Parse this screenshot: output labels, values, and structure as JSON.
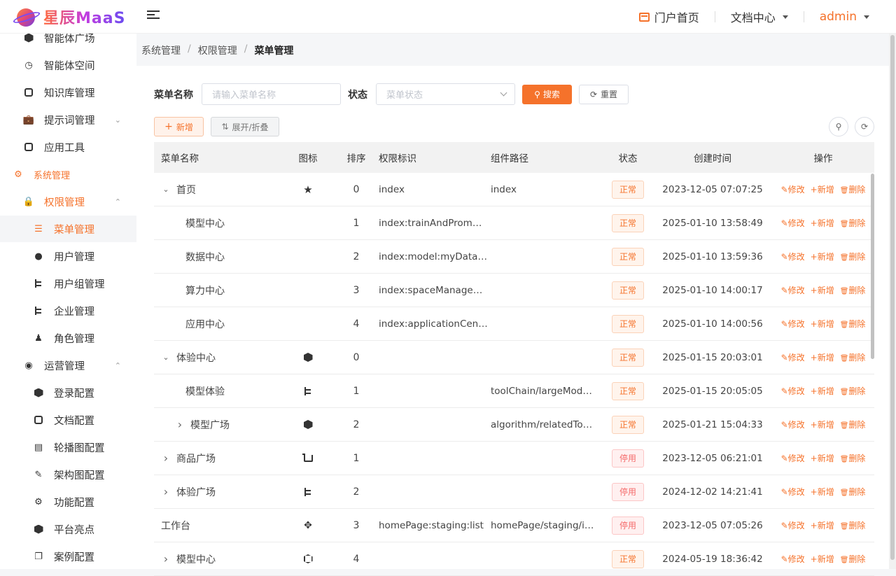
{
  "header": {
    "logo_text": "星辰MaaS",
    "portal": "门户首页",
    "docs": "文档中心",
    "user": "admin"
  },
  "sidebar": {
    "items": [
      {
        "label": "智能体广场",
        "icon": "hexagon-icon",
        "level": 1
      },
      {
        "label": "智能体空间",
        "icon": "clock-icon",
        "level": 1
      },
      {
        "label": "知识库管理",
        "icon": "database-icon",
        "level": 1
      },
      {
        "label": "提示词管理",
        "icon": "briefcase-icon",
        "level": 1,
        "chevron": "down"
      },
      {
        "label": "应用工具",
        "icon": "tools-icon",
        "level": 1
      },
      {
        "label": "系统管理",
        "icon": "gear-icon",
        "level": 0,
        "state": "open"
      },
      {
        "label": "权限管理",
        "icon": "lock-icon",
        "level": 1,
        "chevron": "up",
        "state": "open"
      },
      {
        "label": "菜单管理",
        "icon": "tree-table-icon",
        "level": 2,
        "state": "active"
      },
      {
        "label": "用户管理",
        "icon": "user-icon",
        "level": 2
      },
      {
        "label": "用户组管理",
        "icon": "tree-icon",
        "level": 2
      },
      {
        "label": "企业管理",
        "icon": "tree-icon",
        "level": 2
      },
      {
        "label": "角色管理",
        "icon": "peoples-icon",
        "level": 2
      },
      {
        "label": "运营管理",
        "icon": "operation-icon",
        "level": 1,
        "chevron": "up"
      },
      {
        "label": "登录配置",
        "icon": "hexagon-icon",
        "level": 2
      },
      {
        "label": "文档配置",
        "icon": "document-icon",
        "level": 2
      },
      {
        "label": "轮播图配置",
        "icon": "chart-icon",
        "level": 2
      },
      {
        "label": "架构图配置",
        "icon": "edit-icon",
        "level": 2
      },
      {
        "label": "功能配置",
        "icon": "gear-icon",
        "level": 2
      },
      {
        "label": "平台亮点",
        "icon": "hexagon-icon",
        "level": 2
      },
      {
        "label": "案例配置",
        "icon": "copy-icon",
        "level": 2
      }
    ]
  },
  "breadcrumb": [
    "系统管理",
    "权限管理",
    "菜单管理"
  ],
  "filter": {
    "name_label": "菜单名称",
    "name_placeholder": "请输入菜单名称",
    "status_label": "状态",
    "status_placeholder": "菜单状态",
    "search": "搜索",
    "reset": "重置"
  },
  "toolbar": {
    "add": "新增",
    "expand": "展开/折叠"
  },
  "table": {
    "columns": [
      "菜单名称",
      "图标",
      "排序",
      "权限标识",
      "组件路径",
      "状态",
      "创建时间",
      "操作"
    ],
    "ops": {
      "edit": "修改",
      "add": "新增",
      "delete": "删除"
    },
    "rows": [
      {
        "name": "首页",
        "tree": "expanded",
        "indent": 0,
        "icon": "star-icon",
        "order": "0",
        "perm": "index",
        "path": "index",
        "status": "正常",
        "status_kind": "ok",
        "time": "2023-12-05 07:07:25"
      },
      {
        "name": "模型中心",
        "tree": "leaf",
        "indent": 1,
        "icon": "",
        "order": "1",
        "perm": "index:trainAndProm…",
        "path": "",
        "status": "正常",
        "status_kind": "ok",
        "time": "2025-01-10 13:58:49"
      },
      {
        "name": "数据中心",
        "tree": "leaf",
        "indent": 1,
        "icon": "",
        "order": "2",
        "perm": "index:model:myData…",
        "path": "",
        "status": "正常",
        "status_kind": "ok",
        "time": "2025-01-10 13:59:36"
      },
      {
        "name": "算力中心",
        "tree": "leaf",
        "indent": 1,
        "icon": "",
        "order": "3",
        "perm": "index:spaceManage…",
        "path": "",
        "status": "正常",
        "status_kind": "ok",
        "time": "2025-01-10 14:00:17"
      },
      {
        "name": "应用中心",
        "tree": "leaf",
        "indent": 1,
        "icon": "",
        "order": "4",
        "perm": "index:applicationCen…",
        "path": "",
        "status": "正常",
        "status_kind": "ok",
        "time": "2025-01-10 14:00:56"
      },
      {
        "name": "体验中心",
        "tree": "expanded",
        "indent": 0,
        "icon": "cube-icon",
        "order": "0",
        "perm": "",
        "path": "",
        "status": "正常",
        "status_kind": "ok",
        "time": "2025-01-15 20:03:01"
      },
      {
        "name": "模型体验",
        "tree": "leaf",
        "indent": 1,
        "icon": "tree-icon",
        "order": "1",
        "perm": "",
        "path": "toolChain/largeMod…",
        "status": "正常",
        "status_kind": "ok",
        "time": "2025-01-15 20:05:05"
      },
      {
        "name": "模型广场",
        "tree": "collapsed",
        "indent": 1,
        "icon": "cube-icon",
        "order": "2",
        "perm": "",
        "path": "algorithm/relatedTo…",
        "status": "正常",
        "status_kind": "ok",
        "time": "2025-01-21 15:04:33"
      },
      {
        "name": "商品广场",
        "tree": "collapsed",
        "indent": 0,
        "icon": "cart-icon",
        "order": "1",
        "perm": "",
        "path": "",
        "status": "停用",
        "status_kind": "stop",
        "time": "2023-12-05 06:21:01"
      },
      {
        "name": "体验广场",
        "tree": "collapsed",
        "indent": 0,
        "icon": "tree-icon",
        "order": "2",
        "perm": "",
        "path": "",
        "status": "停用",
        "status_kind": "stop",
        "time": "2024-12-02 14:21:41"
      },
      {
        "name": "工作台",
        "tree": "none",
        "indent": 0,
        "icon": "move-icon",
        "order": "3",
        "perm": "homePage:staging:list",
        "path": "homePage/staging/i…",
        "status": "停用",
        "status_kind": "stop",
        "time": "2023-12-05 07:05:26"
      },
      {
        "name": "模型中心",
        "tree": "collapsed",
        "indent": 0,
        "icon": "box-icon",
        "order": "4",
        "perm": "",
        "path": "",
        "status": "正常",
        "status_kind": "ok",
        "time": "2024-05-19 18:36:42"
      }
    ]
  }
}
